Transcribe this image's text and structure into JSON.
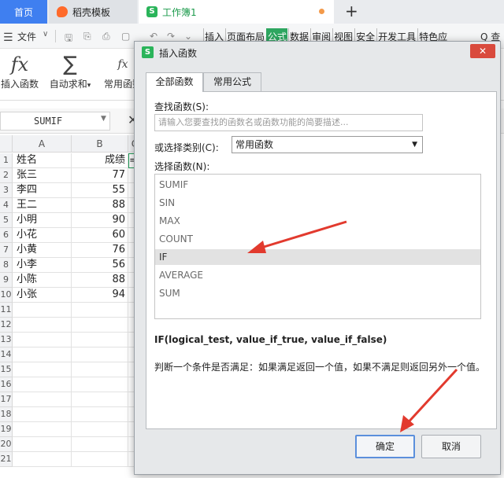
{
  "tabs": {
    "home": "首页",
    "daoke": "稻壳模板",
    "workbook": "工作簿1",
    "add": "+"
  },
  "menubar": {
    "file": "文件",
    "ribbon_tabs": [
      "插入",
      "页面布局",
      "公式",
      "数据",
      "审阅",
      "视图",
      "安全",
      "开发工具",
      "特色应"
    ],
    "active_tab": "公式",
    "search_glyph": "Q 查"
  },
  "ribbon": {
    "insert_function": "插入函数",
    "autosum": "自动求和",
    "common_functions": "常用函数"
  },
  "formula_bar": {
    "name_box": "SUMIF",
    "cancel_glyph": "✕"
  },
  "grid": {
    "col_headers": [
      "A",
      "B",
      "C"
    ],
    "row_numbers": [
      "1",
      "2",
      "3",
      "4",
      "5",
      "6",
      "7",
      "8",
      "9",
      "10",
      "11",
      "12",
      "13",
      "14",
      "15",
      "16",
      "17",
      "18",
      "19",
      "20",
      "21"
    ],
    "header_row": {
      "a": "姓名",
      "b": "成绩",
      "c": "="
    },
    "rows": [
      {
        "a": "张三",
        "b": "77"
      },
      {
        "a": "李四",
        "b": "55"
      },
      {
        "a": "王二",
        "b": "88"
      },
      {
        "a": "小明",
        "b": "90"
      },
      {
        "a": "小花",
        "b": "60"
      },
      {
        "a": "小黄",
        "b": "76"
      },
      {
        "a": "小李",
        "b": "56"
      },
      {
        "a": "小陈",
        "b": "88"
      },
      {
        "a": "小张",
        "b": "94"
      }
    ]
  },
  "dialog": {
    "title": "插入函数",
    "close": "✕",
    "tab_all": "全部函数",
    "tab_common": "常用公式",
    "search_label": "查找函数(S):",
    "search_placeholder": "请输入您要查找的函数名或函数功能的简要描述...",
    "category_label": "或选择类别(C):",
    "category_value": "常用函数",
    "function_label": "选择函数(N):",
    "functions": [
      "SUMIF",
      "SIN",
      "MAX",
      "COUNT",
      "IF",
      "AVERAGE",
      "SUM"
    ],
    "selected_function": "IF",
    "signature": "IF(logical_test, value_if_true, value_if_false)",
    "description": "判断一个条件是否满足：如果满足返回一个值，如果不满足则返回另外一个值。",
    "ok": "确定",
    "cancel": "取消"
  },
  "colors": {
    "accent_green": "#2ea660",
    "home_tab_blue": "#3f7ff0",
    "arrow_red": "#e23a2e",
    "close_red": "#d94a3d"
  }
}
